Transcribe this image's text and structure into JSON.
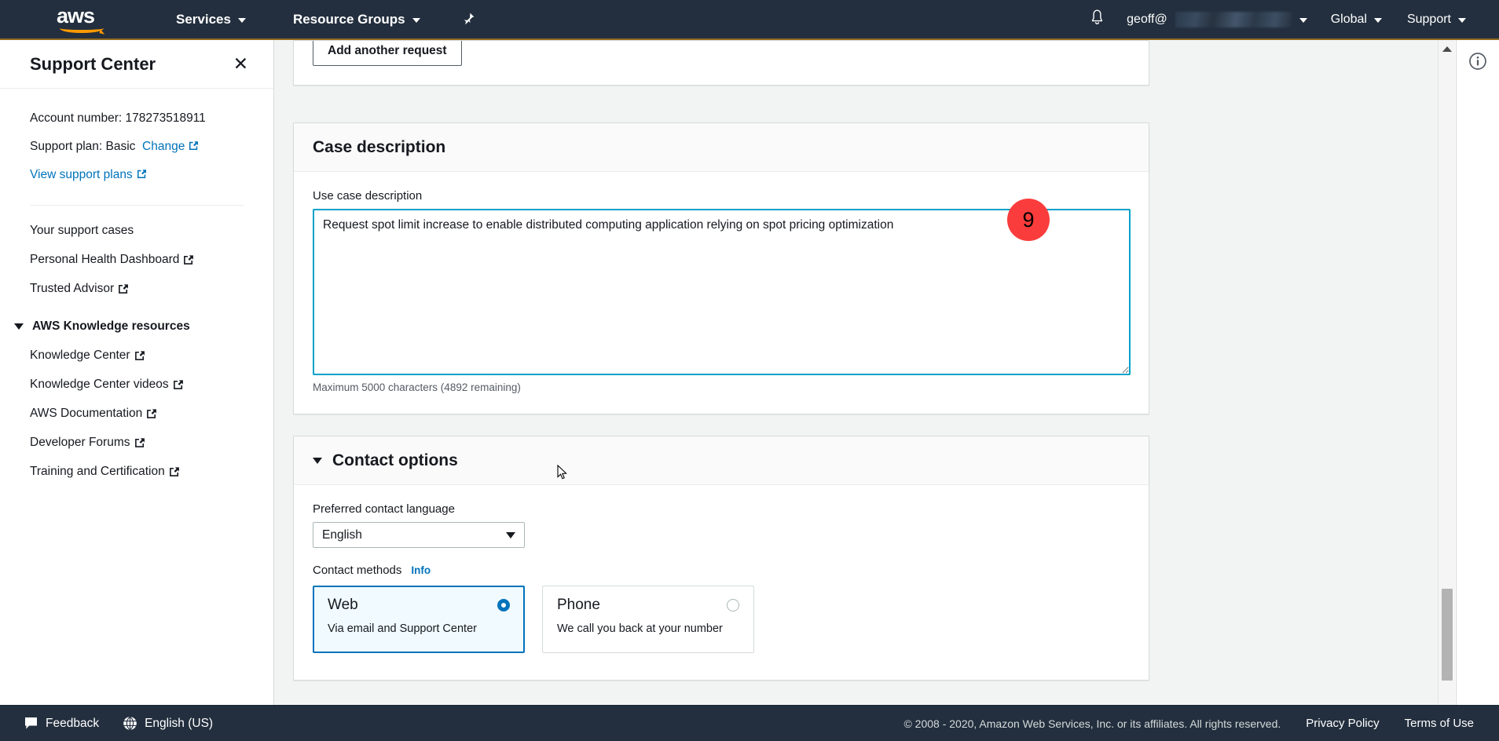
{
  "topnav": {
    "logo_alt": "aws",
    "services_label": "Services",
    "resource_groups_label": "Resource Groups",
    "pin_icon": "pin-icon",
    "bell_icon": "bell-notification-icon",
    "account_label": "geoff@",
    "account_redacted": true,
    "global_label": "Global",
    "support_label": "Support"
  },
  "sidebar": {
    "title": "Support Center",
    "close_icon": "close-icon",
    "account_number_label": "Account number: 178273518911",
    "support_plan_label": "Support plan: Basic",
    "change_link": "Change",
    "view_plans_link": "View support plans",
    "links": [
      {
        "label": "Your support cases",
        "external": false
      },
      {
        "label": "Personal Health Dashboard",
        "external": true
      },
      {
        "label": "Trusted Advisor",
        "external": true
      }
    ],
    "group_title": "AWS Knowledge resources",
    "group_links": [
      {
        "label": "Knowledge Center",
        "external": true
      },
      {
        "label": "Knowledge Center videos",
        "external": true
      },
      {
        "label": "AWS Documentation",
        "external": true
      },
      {
        "label": "Developer Forums",
        "external": true
      },
      {
        "label": "Training and Certification",
        "external": true
      }
    ]
  },
  "main": {
    "add_another_request_label": "Add another request",
    "case_description": {
      "header": "Case description",
      "field_label": "Use case description",
      "textarea_value": "Request spot limit increase to enable distributed computing application relying on spot pricing optimization",
      "char_counter": "Maximum 5000 characters (4892 remaining)"
    },
    "contact_options": {
      "header": "Contact options",
      "language_label": "Preferred contact language",
      "language_value": "English",
      "contact_methods_label": "Contact methods",
      "info_label": "Info",
      "methods": [
        {
          "title": "Web",
          "subtitle": "Via email and Support Center",
          "selected": true
        },
        {
          "title": "Phone",
          "subtitle": "We call you back at your number",
          "selected": false
        }
      ]
    }
  },
  "annotation": {
    "badge_number": "9",
    "badge_color": "#fa3c3c"
  },
  "right_panel": {
    "info_icon": "info-circle-icon"
  },
  "scrollbar": {
    "up_icon": "scroll-up-arrow-icon",
    "down_icon": "scroll-down-arrow-icon"
  },
  "footer": {
    "feedback_label": "Feedback",
    "feedback_icon": "speech-bubble-icon",
    "language_label": "English (US)",
    "language_icon": "globe-icon",
    "copyright": "© 2008 - 2020, Amazon Web Services, Inc. or its affiliates. All rights reserved.",
    "privacy_label": "Privacy Policy",
    "terms_label": "Terms of Use"
  },
  "colors": {
    "nav_bg": "#232f3e",
    "accent_orange": "#ff9900",
    "link_blue": "#0073bb",
    "focus_teal": "#00a1c9",
    "selected_card_bg": "#f1faff",
    "page_bg": "#f2f3f3"
  }
}
